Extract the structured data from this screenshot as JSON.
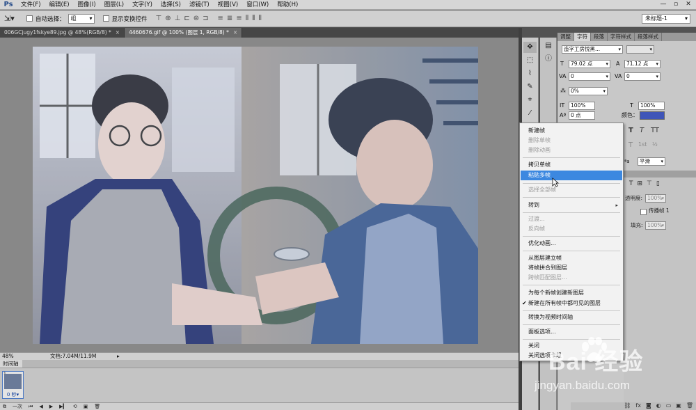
{
  "app": {
    "logo": "Ps"
  },
  "menu": [
    "文件(F)",
    "编辑(E)",
    "图像(I)",
    "图层(L)",
    "文字(Y)",
    "选择(S)",
    "滤镜(T)",
    "视图(V)",
    "窗口(W)",
    "帮助(H)"
  ],
  "options_bar": {
    "auto_select_label": "自动选择：",
    "auto_select_value": "组",
    "show_transform_label": "显示变换控件",
    "workspace": "未标题-1"
  },
  "tabs": [
    {
      "label": "006GCjugy1fskye89.jpg @ 48%(RGB/8) *",
      "active": false
    },
    {
      "label": "4460676.gif @ 100% (图层 1, RGB/8) *",
      "active": true
    }
  ],
  "status": {
    "zoom": "48%",
    "doc": "文档:7.04M/11.9M"
  },
  "timeline": {
    "tab_label": "时间轴",
    "frame_number": "1",
    "frame_time": "0 秒▾",
    "loop": "一次"
  },
  "character_panel": {
    "tabs": [
      "调整",
      "字符",
      "段落",
      "字符样式",
      "段落样式"
    ],
    "font_family": "造字工房悦黑...",
    "font_size": "79.02 点",
    "leading": "71.12 点",
    "kerning": "0",
    "tracking": "0",
    "scale_label": "0%",
    "vertical_scale": "100%",
    "horizontal_scale": "100%",
    "baseline_shift": "0 点",
    "color_label": "颜色：",
    "color": "#3f55b8",
    "antialias": "平滑"
  },
  "layers_panel": {
    "opacity_label": "透明度:",
    "opacity": "100%",
    "propagate_label": "传播帧 1",
    "fill_label": "填充:",
    "fill": "100%"
  },
  "context_menu": {
    "items": [
      {
        "label": "新建帧",
        "disabled": false
      },
      {
        "label": "删除单帧",
        "disabled": true
      },
      {
        "label": "删除动画",
        "disabled": true
      },
      {
        "label": "拷贝单帧",
        "disabled": false
      },
      {
        "label": "粘贴多帧",
        "disabled": false,
        "highlighted": true
      },
      {
        "label": "选择全部帧",
        "disabled": true
      },
      {
        "label": "转到",
        "disabled": false,
        "submenu": true
      },
      {
        "label": "过渡...",
        "disabled": true
      },
      {
        "label": "反向帧",
        "disabled": true
      },
      {
        "label": "优化动画...",
        "disabled": false
      },
      {
        "label": "从图层建立帧",
        "disabled": false
      },
      {
        "label": "将帧拼合到图层",
        "disabled": false
      },
      {
        "label": "跨帧匹配图层...",
        "disabled": true
      },
      {
        "label": "为每个新帧创建新图层",
        "disabled": false
      },
      {
        "label": "新建在所有帧中都可见的图层",
        "disabled": false,
        "checked": true
      },
      {
        "label": "转换为视频时间轴",
        "disabled": false
      },
      {
        "label": "面板选项...",
        "disabled": false
      },
      {
        "label": "关闭",
        "disabled": false
      },
      {
        "label": "关闭选项卡组",
        "disabled": false
      }
    ]
  },
  "watermark": {
    "brand": "Bai 经验",
    "url": "jingyan.baidu.com"
  }
}
